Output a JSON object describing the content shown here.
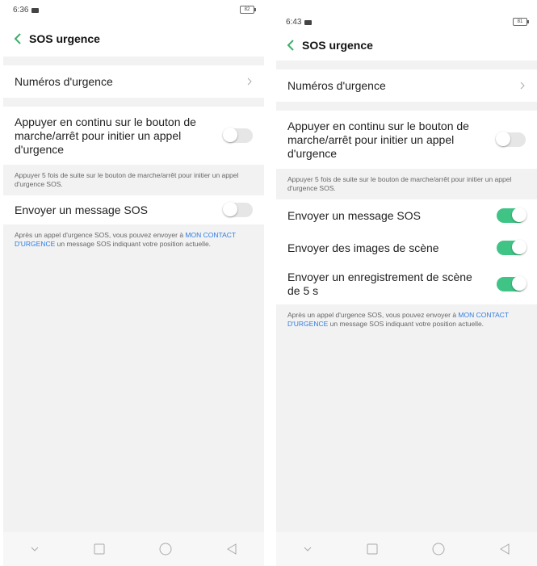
{
  "colors": {
    "accent": "#2f7ce0",
    "toggle_on": "#3fc486",
    "toggle_off": "#e6e6e6",
    "back_arrow": "#3fae6a"
  },
  "left": {
    "status_time": "6:36",
    "battery": "82",
    "title": "SOS urgence",
    "emergency_numbers": "Numéros d'urgence",
    "power_press_label": "Appuyer en continu sur le bouton de marche/arrêt pour initier un appel d'urgence",
    "power_press_on": false,
    "power_press_note": "Appuyer 5 fois de suite sur le bouton de marche/arrêt pour initier un appel d'urgence SOS.",
    "sos_message_label": "Envoyer un message SOS",
    "sos_message_on": false,
    "footer_note_pre": "Après un appel d'urgence SOS, vous pouvez envoyer à ",
    "footer_note_link": "MON CONTACT D'URGENCE",
    "footer_note_post": " un message SOS indiquant votre position actuelle."
  },
  "right": {
    "status_time": "6:43",
    "battery": "81",
    "title": "SOS urgence",
    "emergency_numbers": "Numéros d'urgence",
    "power_press_label": "Appuyer en continu sur le bouton de marche/arrêt pour initier un appel d'urgence",
    "power_press_on": false,
    "power_press_note": "Appuyer 5 fois de suite sur le bouton de marche/arrêt pour initier un appel d'urgence SOS.",
    "sos_message_label": "Envoyer un message SOS",
    "sos_message_on": true,
    "scene_images_label": "Envoyer des images de scène",
    "scene_images_on": true,
    "scene_recording_label": "Envoyer un enregistrement de scène de 5 s",
    "scene_recording_on": true,
    "footer_note_pre": "Après un appel d'urgence SOS, vous pouvez envoyer à ",
    "footer_note_link": "MON CONTACT D'URGENCE",
    "footer_note_post": " un message SOS indiquant votre position actuelle."
  },
  "navbar_icons": [
    "chevron-down-icon",
    "square-icon",
    "circle-icon",
    "triangle-back-icon"
  ]
}
